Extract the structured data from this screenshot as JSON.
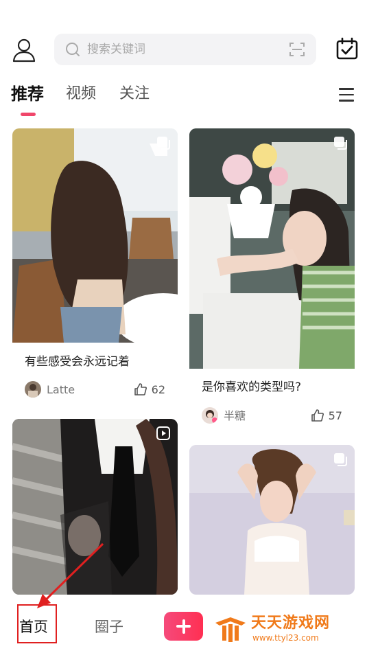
{
  "search": {
    "placeholder": "搜索关键词"
  },
  "tabs": [
    {
      "label": "推荐",
      "active": true
    },
    {
      "label": "视频",
      "active": false
    },
    {
      "label": "关注",
      "active": false
    }
  ],
  "feed": [
    {
      "title": "有些感受会永远记着",
      "user": "Latte",
      "likes": "62",
      "type": "multi-image"
    },
    {
      "title": "是你喜欢的类型吗?",
      "user": "半糖",
      "likes": "57",
      "type": "multi-image"
    },
    {
      "title": "",
      "user": "",
      "likes": "",
      "type": "video"
    },
    {
      "title": "",
      "user": "",
      "likes": "",
      "type": "multi-image"
    }
  ],
  "bottom_nav": {
    "home_label": "首页",
    "circle_label": "圈子"
  },
  "watermark": {
    "title": "天天游戏网",
    "url": "www.ttyl23.com"
  },
  "colors": {
    "accent": "#f0466a",
    "add_button": "#ff2f52",
    "annotation": "#e02020",
    "watermark": "#f07a1a"
  }
}
